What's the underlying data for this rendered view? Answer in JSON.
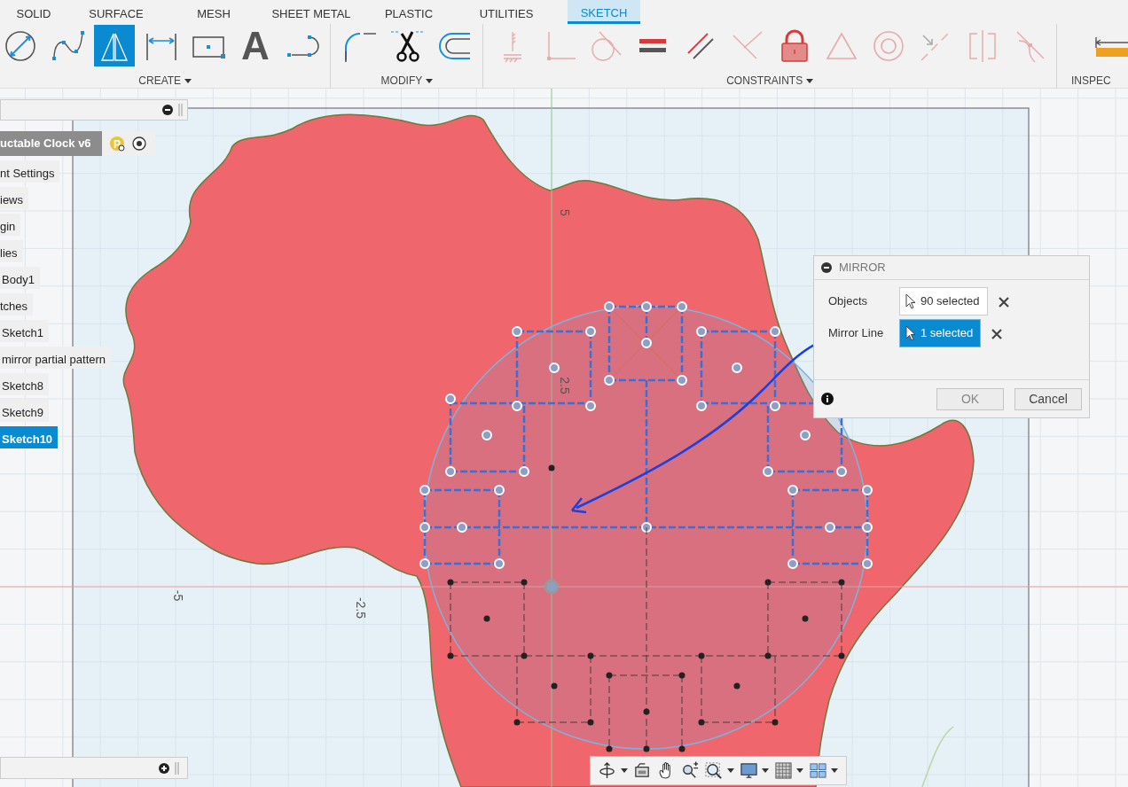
{
  "toolbar": {
    "tabs": [
      {
        "label": "SOLID",
        "selected": false
      },
      {
        "label": "SURFACE",
        "selected": false
      },
      {
        "label": "MESH",
        "selected": false
      },
      {
        "label": "SHEET METAL",
        "selected": false
      },
      {
        "label": "PLASTIC",
        "selected": false
      },
      {
        "label": "UTILITIES",
        "selected": false
      },
      {
        "label": "SKETCH",
        "selected": true
      }
    ],
    "groups": [
      {
        "label": "CREATE",
        "tools": [
          {
            "kind": "circle",
            "selected": false
          },
          {
            "kind": "spline",
            "selected": false
          },
          {
            "kind": "mirror",
            "selected": true
          },
          {
            "kind": "dimension",
            "selected": false
          },
          {
            "kind": "rectangle",
            "selected": false
          },
          {
            "kind": "text",
            "glyph": "A",
            "selected": false
          },
          {
            "kind": "slot",
            "selected": false
          }
        ]
      },
      {
        "label": "MODIFY",
        "tools": [
          {
            "kind": "fillet",
            "selected": false
          },
          {
            "kind": "trim",
            "selected": false
          },
          {
            "kind": "offset",
            "selected": false
          }
        ]
      },
      {
        "label": "CONSTRAINTS",
        "tools": [
          {
            "kind": "horizontal",
            "selected": false
          },
          {
            "kind": "coincident",
            "selected": false
          },
          {
            "kind": "tangent",
            "selected": false
          },
          {
            "kind": "equal",
            "selected": false
          },
          {
            "kind": "parallel",
            "selected": false
          },
          {
            "kind": "perpendicular",
            "selected": false
          },
          {
            "kind": "lock",
            "selected": false
          },
          {
            "kind": "triangle",
            "selected": false
          },
          {
            "kind": "concentric",
            "selected": false
          },
          {
            "kind": "collinear",
            "selected": false
          },
          {
            "kind": "symmetric",
            "selected": false
          },
          {
            "kind": "curvature",
            "selected": false
          }
        ]
      },
      {
        "label": "INSPEC",
        "tools": [
          {
            "kind": "ruler",
            "selected": false
          }
        ]
      }
    ]
  },
  "browser": {
    "root": "uctable Clock v6",
    "root_badge": "P",
    "items": [
      {
        "label": "nt Settings",
        "selected": false
      },
      {
        "label": "iews",
        "selected": false
      },
      {
        "label": "gin",
        "selected": false
      },
      {
        "label": "lies",
        "selected": false
      },
      {
        "label": "Body1",
        "selected": false
      },
      {
        "label": "tches",
        "selected": false
      },
      {
        "label": "Sketch1",
        "selected": false
      },
      {
        "label": "mirror partial pattern",
        "selected": false
      },
      {
        "label": "Sketch8",
        "selected": false
      },
      {
        "label": "Sketch9",
        "selected": false
      },
      {
        "label": "Sketch10",
        "selected": true
      }
    ]
  },
  "canvas": {
    "axis_labels": [
      "5",
      "2.5",
      "-5",
      "-2.5"
    ]
  },
  "mirror_dialog": {
    "title": "MIRROR",
    "fields": [
      {
        "label": "Objects",
        "value": "90 selected",
        "selected": false
      },
      {
        "label": "Mirror Line",
        "value": "1 selected",
        "selected": true
      }
    ],
    "buttons": [
      "OK",
      "Cancel"
    ]
  },
  "nav_bar": {
    "tools": [
      {
        "kind": "orbit",
        "menu": true
      },
      {
        "kind": "look",
        "menu": false
      },
      {
        "kind": "pan",
        "menu": false
      },
      {
        "kind": "zoom",
        "menu": false
      },
      {
        "kind": "fit",
        "menu": true
      },
      {
        "kind": "display",
        "menu": true
      },
      {
        "kind": "grid",
        "menu": true
      },
      {
        "kind": "viewports",
        "menu": true
      }
    ]
  }
}
